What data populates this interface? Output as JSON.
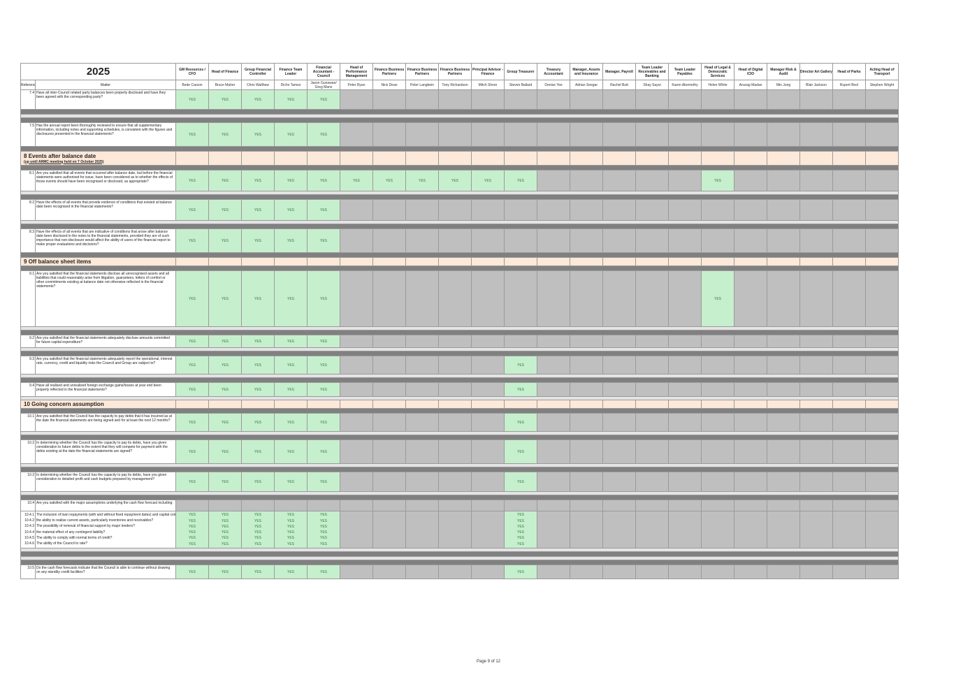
{
  "year": "2025",
  "header": {
    "reference_label": "Reference",
    "matter_label": "Matter"
  },
  "columns": [
    {
      "role": "GM Resources / CFO",
      "person": "Bede Carson"
    },
    {
      "role": "Head of Finance",
      "person": "Bruce Maher"
    },
    {
      "role": "Group Financial Controller",
      "person": "Chris Walthew"
    },
    {
      "role": "Finance Team Leader",
      "person": "Dicho Tamso"
    },
    {
      "role": "Financial Accountant - Council",
      "person": "Jason Gunawan/ Greg Manx"
    },
    {
      "role": "Head of Performance Management",
      "person": "Peter Ryan"
    },
    {
      "role": "Finance Business Partners",
      "person": "Nick Dean"
    },
    {
      "role": "Finance Business Partners",
      "person": "Peter Langbein"
    },
    {
      "role": "Finance Business Partners",
      "person": "Tony Richardson"
    },
    {
      "role": "Principal Advisor - Finance",
      "person": "Mitch Shore"
    },
    {
      "role": "Group Treasurer",
      "person": "Steven Ballard"
    },
    {
      "role": "Treasury Accountant",
      "person": "Denise Yee"
    },
    {
      "role": "Manager, Assets and Insurance",
      "person": "Adrian Seegar"
    },
    {
      "role": "Manager, Payroll",
      "person": "Rachel Butt"
    },
    {
      "role": "Team Leader Receivables and Banking",
      "person": "Shay Sayoi"
    },
    {
      "role": "Team Leader Payables",
      "person": "Karen Abernethy"
    },
    {
      "role": "Head of Legal & Democratic Services",
      "person": "Helen White"
    },
    {
      "role": "Head of Digital /CIO",
      "person": "Anurag Madan"
    },
    {
      "role": "Manager Risk & Audit",
      "person": "Min Jung"
    },
    {
      "role": "Director Art Gallery",
      "person": "Blair Jackson"
    },
    {
      "role": "Head of Parks",
      "person": "Rupert Bool"
    },
    {
      "role": "Acting Head of Transport",
      "person": "Stephen Wright"
    }
  ],
  "rows": [
    {
      "kind": "item",
      "ref": "7.4",
      "text": "Have all inter-Council related party balances been properly disclosed and have they been agreed with the corresponding party?",
      "yes": [
        0,
        1,
        2,
        3,
        4
      ],
      "h": 28
    },
    {
      "kind": "dark"
    },
    {
      "kind": "light"
    },
    {
      "kind": "dark"
    },
    {
      "kind": "item",
      "ref": "7.5",
      "text": "Has the annual report been thoroughly reviewed to ensure that all supplementary information, including notes and supporting schedules, is consistent with the figures and disclosures presented in the financial statements?",
      "yes": [
        0,
        1,
        2,
        3,
        4
      ],
      "h": 34
    },
    {
      "kind": "dark"
    },
    {
      "kind": "section",
      "num": "8",
      "title": "Events after balance date",
      "sub": "(up until ARMC meeting held on 7 October 2025)"
    },
    {
      "kind": "dark"
    },
    {
      "kind": "item",
      "ref": "8.1",
      "text": "Are you satisfied that all events that occurred after balance date, but before the financial statements were authorised for issue, have been considered as to whether the effects of those events should have been recognised or disclosed, as appropriate?",
      "yes": [
        0,
        1,
        2,
        3,
        4,
        5,
        6,
        7,
        8,
        9,
        10,
        16
      ],
      "h": 30
    },
    {
      "kind": "light"
    },
    {
      "kind": "dark"
    },
    {
      "kind": "item",
      "ref": "8.2",
      "text": "Have the effects of all events that provide evidence of conditions that existed at balance date been recognised in the financial statements?",
      "yes": [
        0,
        1,
        2,
        3,
        4
      ],
      "h": 30
    },
    {
      "kind": "light"
    },
    {
      "kind": "dark"
    },
    {
      "kind": "item",
      "ref": "8.3",
      "text": "Have the effects of all events that are indicative of conditions that arose after balance date been disclosed in the notes to the financial statements, provided they are of such importance that non-disclosure would affect the ability of users of the financial report to make proper evaluations and decisions?",
      "yes": [
        0,
        1,
        2,
        3,
        4
      ],
      "h": 34
    },
    {
      "kind": "dark"
    },
    {
      "kind": "section",
      "num": "9",
      "title": "Off balance sheet items",
      "sub": ""
    },
    {
      "kind": "dark"
    },
    {
      "kind": "item",
      "ref": "9.1",
      "text": "Are you satisfied that the financial statements disclose all unrecognised assets and all liabilities that could reasonably arise from litigation, guarantees, letters of comfort or other commitments existing at balance date not otherwise reflected in the financial statements?",
      "yes": [
        0,
        1,
        2,
        3,
        4,
        16
      ],
      "h": 80
    },
    {
      "kind": "light"
    },
    {
      "kind": "dark"
    },
    {
      "kind": "item",
      "ref": "9.2",
      "text": "Are you satisfied that the financial statements adequately disclose amounts committed for future capital expenditure?",
      "yes": [
        0,
        1,
        2,
        3,
        4
      ],
      "h": 18
    },
    {
      "kind": "light"
    },
    {
      "kind": "dark"
    },
    {
      "kind": "item",
      "ref": "9.3",
      "text": "Are you satisfied that the financial statements adequately report the operational, interest rate, currency, credit and liquidity risks the Council and Group are subject to?",
      "yes": [
        0,
        1,
        2,
        3,
        4,
        10
      ],
      "h": 26
    },
    {
      "kind": "light"
    },
    {
      "kind": "dark"
    },
    {
      "kind": "item",
      "ref": "9.4",
      "text": "Have all realised and unrealised foreign exchange gains/losses at year end been properly reflected in the financial statements?",
      "yes": [
        0,
        1,
        2,
        3,
        4,
        10
      ],
      "h": 20
    },
    {
      "kind": "light"
    },
    {
      "kind": "section",
      "num": "10",
      "title": "Going concern assumption",
      "sub": ""
    },
    {
      "kind": "dark"
    },
    {
      "kind": "item",
      "ref": "10.1",
      "text": "Are you satisfied that the Council has the capacity to pay debts that it has incurred as at the date the financial statements are being signed and for at least the next 12 months?",
      "yes": [
        0,
        1,
        2,
        3,
        4,
        10
      ],
      "h": 26
    },
    {
      "kind": "light"
    },
    {
      "kind": "dark"
    },
    {
      "kind": "item",
      "ref": "10.2",
      "text": "In determining whether the Council has the capacity to pay its debts, have you given consideration to future debts to the extent that they will compete for payment with the debts existing at the date the financial statements are signed?",
      "yes": [
        0,
        1,
        2,
        3,
        4,
        10
      ],
      "h": 34
    },
    {
      "kind": "light"
    },
    {
      "kind": "dark"
    },
    {
      "kind": "item",
      "ref": "10.3",
      "text": "In determining whether the Council has the capacity to pay its debts, have you given consideration to detailed profit and cash budgets prepared by management?",
      "yes": [
        0,
        1,
        2,
        3,
        4,
        10
      ],
      "h": 28
    },
    {
      "kind": "light"
    },
    {
      "kind": "dark"
    },
    {
      "kind": "multi",
      "ref": "10.4",
      "text": "Are you satisfied with the major assumptions underlying the cash flow forecast including:",
      "yes": [
        0,
        1,
        2,
        3,
        4,
        10
      ],
      "subs": [
        {
          "ref": "10.4.1",
          "text": "The inclusion of loan repayments (with and without fixed repayment dates) and capital commitments?"
        },
        {
          "ref": "10.4.2",
          "text": "the ability to realise current assets, particularly inventories and receivables?"
        },
        {
          "ref": "10.4.3",
          "text": "The possibility of removal of financial support by major lenders?"
        },
        {
          "ref": "10.4.4",
          "text": "the material effect of any contingent liability?"
        },
        {
          "ref": "10.4.5",
          "text": "The ability to comply with normal terms of credit?"
        },
        {
          "ref": "10.4.6",
          "text": "The ability of the Council to rate?"
        }
      ]
    },
    {
      "kind": "light"
    },
    {
      "kind": "dark"
    },
    {
      "kind": "light"
    },
    {
      "kind": "dark"
    },
    {
      "kind": "item",
      "ref": "10.5",
      "text": "Do the cash flow forecasts indicate that the Council is able to continue without drawing on any standby credit facilities?",
      "yes": [
        0,
        1,
        2,
        3,
        4,
        10
      ],
      "h": 20
    }
  ],
  "yes_label": "YES",
  "footer": "Page 9 of 12",
  "colors": {
    "yes_fill": "#c6efce",
    "yes_text": "#2e7d32",
    "grey": "#bfbfbf",
    "dark": "#808080",
    "section": "#fde9d9"
  }
}
